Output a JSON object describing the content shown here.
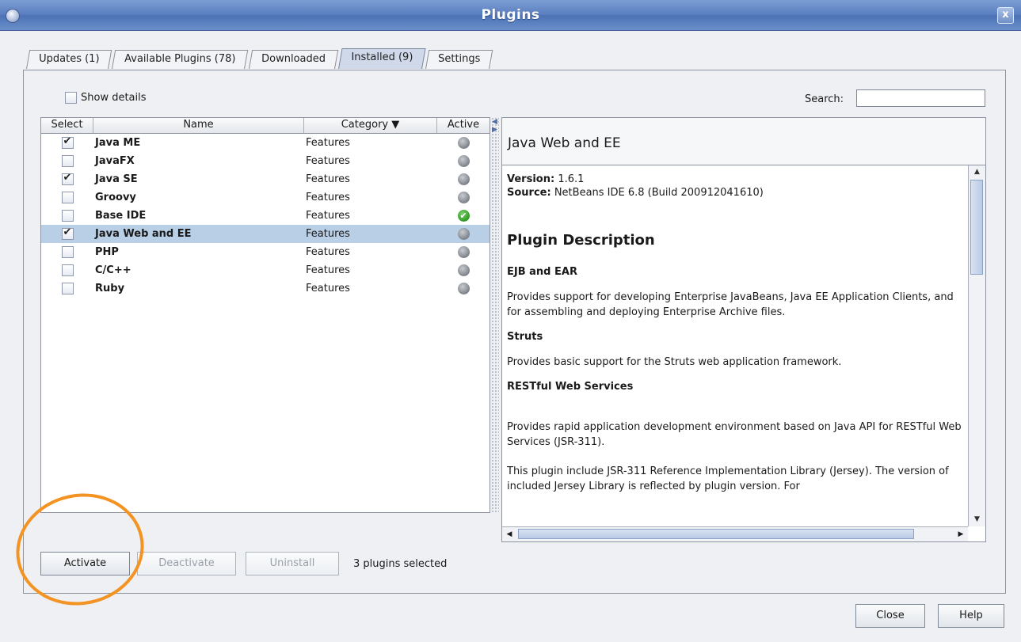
{
  "window": {
    "title": "Plugins",
    "close_label": "x"
  },
  "tabs": [
    {
      "label": "Updates (1)",
      "active": false
    },
    {
      "label": "Available Plugins (78)",
      "active": false
    },
    {
      "label": "Downloaded",
      "active": false
    },
    {
      "label": "Installed (9)",
      "active": true
    },
    {
      "label": "Settings",
      "active": false
    }
  ],
  "toolbar": {
    "show_details_label": "Show details",
    "show_details_checked": false,
    "search_label": "Search:",
    "search_value": ""
  },
  "table": {
    "headers": {
      "select": "Select",
      "name": "Name",
      "category": "Category ▼",
      "active": "Active"
    },
    "rows": [
      {
        "checked": true,
        "name": "Java ME",
        "category": "Features",
        "active": false,
        "selected": false
      },
      {
        "checked": false,
        "name": "JavaFX",
        "category": "Features",
        "active": false,
        "selected": false
      },
      {
        "checked": true,
        "name": "Java SE",
        "category": "Features",
        "active": false,
        "selected": false
      },
      {
        "checked": false,
        "name": "Groovy",
        "category": "Features",
        "active": false,
        "selected": false
      },
      {
        "checked": false,
        "name": "Base IDE",
        "category": "Features",
        "active": true,
        "selected": false
      },
      {
        "checked": true,
        "name": "Java Web and EE",
        "category": "Features",
        "active": false,
        "selected": true
      },
      {
        "checked": false,
        "name": "PHP",
        "category": "Features",
        "active": false,
        "selected": false
      },
      {
        "checked": false,
        "name": "C/C++",
        "category": "Features",
        "active": false,
        "selected": false
      },
      {
        "checked": false,
        "name": "Ruby",
        "category": "Features",
        "active": false,
        "selected": false
      }
    ]
  },
  "detail": {
    "title": "Java Web and EE",
    "version_label": "Version:",
    "version_value": "1.6.1",
    "source_label": "Source:",
    "source_value": "NetBeans IDE 6.8 (Build 200912041610)",
    "description_heading": "Plugin Description",
    "sections": [
      {
        "title": "EJB and EAR",
        "text": "Provides support for developing Enterprise JavaBeans, Java EE Application Clients, and for assembling and deploying Enterprise Archive files."
      },
      {
        "title": "Struts",
        "text": "Provides basic support for the Struts web application framework."
      },
      {
        "title": "RESTful Web Services",
        "text": "Provides rapid application development environment based on Java API for RESTful Web Services (JSR-311)."
      }
    ],
    "extra_text": "This plugin include JSR-311 Reference Implementation Library (Jersey). The version of included Jersey Library is reflected by plugin version. For"
  },
  "actions": {
    "activate": "Activate",
    "deactivate": "Deactivate",
    "uninstall": "Uninstall",
    "status": "3 plugins selected"
  },
  "footer": {
    "close": "Close",
    "help": "Help"
  },
  "colors": {
    "highlight": "#f39322",
    "selection": "#b8cfe5",
    "titlebar": "#5a7fc0"
  }
}
